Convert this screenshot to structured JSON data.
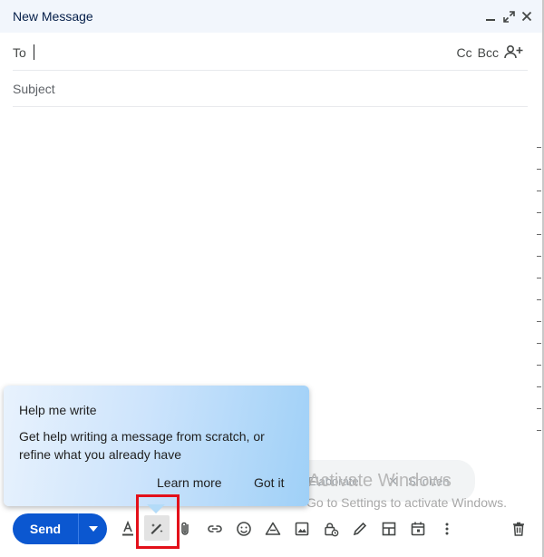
{
  "window": {
    "title": "New Message"
  },
  "titlebar_icons": [
    "minimize-icon",
    "expand-icon",
    "close-icon"
  ],
  "to": {
    "label": "To",
    "value": ""
  },
  "cc": {
    "cc_label": "Cc",
    "bcc_label": "Bcc"
  },
  "subject": {
    "placeholder": "Subject"
  },
  "popup": {
    "title": "Help me write",
    "text": "Get help writing a message from scratch, or refine what you already have",
    "learn_more": "Learn more",
    "got_it": "Got it"
  },
  "watermark": {
    "title": "Activate Windows",
    "subtitle": "Go to Settings to activate Windows.",
    "chip1": "Elaborate",
    "chip2": "Shorten"
  },
  "toolbar": {
    "send_label": "Send",
    "icons": [
      "formatting-icon",
      "help-me-write-icon",
      "attach-icon",
      "link-icon",
      "emoji-icon",
      "drive-icon",
      "photo-icon",
      "confidential-icon",
      "signature-icon",
      "layouts-icon",
      "schedule-icon",
      "more-options-icon",
      "discard-icon"
    ]
  },
  "colors": {
    "send": "#0b57d0",
    "titlebar": "#f2f6fc",
    "highlight": "#e3101a"
  }
}
